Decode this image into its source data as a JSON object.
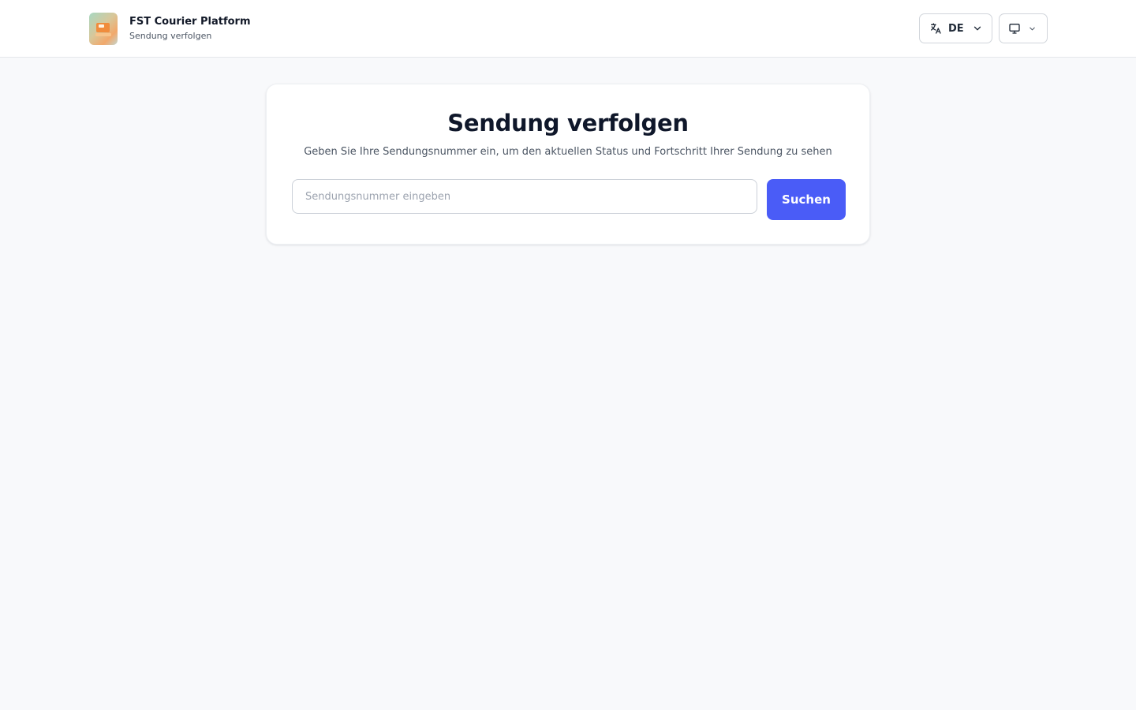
{
  "header": {
    "brand_title": "FST Courier Platform",
    "brand_subtitle": "Sendung verfolgen",
    "logo_icon": "delivery-truck-icon",
    "language": {
      "icon": "translate-icon",
      "selected": "DE"
    },
    "device": {
      "icon": "monitor-icon"
    }
  },
  "tracking": {
    "title": "Sendung verfolgen",
    "description": "Geben Sie Ihre Sendungsnummer ein, um den aktuellen Status und Fortschritt Ihrer Sendung zu sehen",
    "input_value": "",
    "input_placeholder": "Sendungsnummer eingeben",
    "button_label": "Suchen"
  },
  "colors": {
    "page_background": "#f8f9fb",
    "accent": "#4a5cf7",
    "card_background": "#ffffff"
  }
}
